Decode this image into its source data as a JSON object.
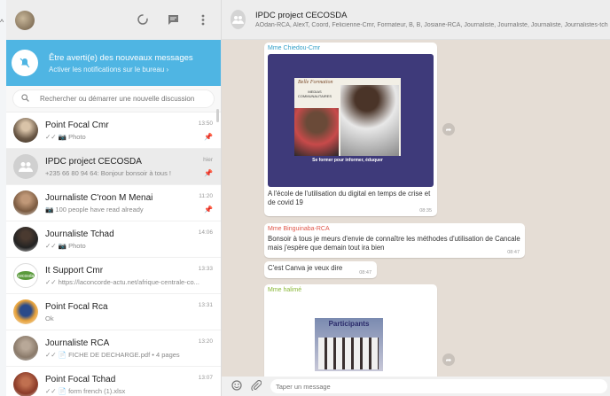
{
  "sidebar": {
    "notification": {
      "title": "Être averti(e) des nouveaux messages",
      "subtitle": "Activer les notifications sur le bureau ›"
    },
    "search": {
      "placeholder": "Rechercher ou démarrer une nouvelle discussion"
    },
    "chats": [
      {
        "name": "Point Focal Cmr",
        "preview": "✓✓ 📷 Photo",
        "time": "13:50",
        "pinned": true,
        "avatar_color": "#7a6a58"
      },
      {
        "name": "IPDC project CECOSDA",
        "preview": "+235 66 80 94 64: Bonjour bonsoir à tous !",
        "time": "hier",
        "pinned": true,
        "active": true,
        "avatar_color": "#cfcfcf"
      },
      {
        "name": "Journaliste C'roon M Menai",
        "preview": "📷 100 people have read already",
        "time": "11:20",
        "pinned": true,
        "avatar_color": "#9b7b5e"
      },
      {
        "name": "Journaliste Tchad",
        "preview": "✓✓ 📷 Photo",
        "time": "14:06",
        "pinned": false,
        "avatar_color": "#3a3a3a"
      },
      {
        "name": "It Support Cmr",
        "preview": "✓✓ https://laconcorde-actu.net/afrique-centrale-co...",
        "time": "13:33",
        "pinned": false,
        "avatar_color": "#4a8a3a"
      },
      {
        "name": "Point Focal Rca",
        "preview": "Ok",
        "time": "13:31",
        "pinned": false,
        "avatar_color": "#d98a2a"
      },
      {
        "name": "Journaliste RCA",
        "preview": "✓✓ 📄 FICHE DE DECHARGE.pdf • 4 pages",
        "time": "13:20",
        "pinned": false,
        "avatar_color": "#a0a0a0"
      },
      {
        "name": "Point Focal Tchad",
        "preview": "✓✓ 📄 form french (1).xlsx",
        "time": "13:07",
        "pinned": false,
        "avatar_color": "#b0553c"
      }
    ]
  },
  "main": {
    "header": {
      "title": "IPDC project CECOSDA",
      "members": "AOdan-RCA, AlexT, Coord, Felicienne-Cmr, Formateur, B, B, Josiane-RCA, Journaliste, Journaliste, Journaliste, Journalistes-tch"
    },
    "messages": [
      {
        "sender": "Mme Chiedou-Cmr",
        "sender_color": "#35a0c8",
        "image_caption_top": "Belle Formation",
        "image_caption_mid": "MEDIAS COMMUNAUTAIRES",
        "image_caption_bottom": "Se former pour informer, éduquer",
        "text": "A l'école de l'utilisation du digital en temps de crise et de covid 19",
        "time": "08:35"
      },
      {
        "sender": "Mme Binguinaba-RCA",
        "sender_color": "#e0574a",
        "text": "Bonsoir à tous je meurs d'envie de connaître les méthodes d'utilisation de Cancale mais j'espère que demain tout ira bien",
        "time": "08:47"
      },
      {
        "text": "C'est Canva je veux dire",
        "time": "08:47"
      },
      {
        "sender": "Mme halimé",
        "sender_color": "#8bb83a",
        "image_caption_top": "Participants"
      }
    ],
    "composer": {
      "placeholder": "Taper un message"
    }
  }
}
